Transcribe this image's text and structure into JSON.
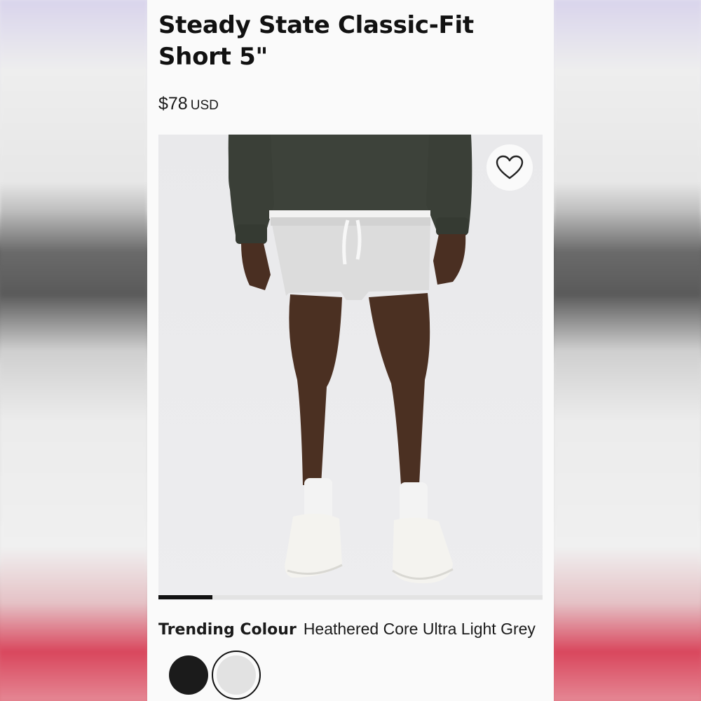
{
  "product": {
    "title": "Steady State Classic-Fit Short 5\"",
    "price": "$78",
    "currency": "USD"
  },
  "gallery": {
    "favorite_icon": "heart-outline-icon",
    "progress": 0.14
  },
  "colour": {
    "label": "Trending Colour",
    "selected_name": "Heathered Core Ultra Light Grey",
    "swatches": [
      {
        "name": "Black",
        "color": "#1b1b1b",
        "selected": false
      },
      {
        "name": "Heathered Core Ultra Light Grey",
        "color": "#e2e2e2",
        "selected": true
      }
    ]
  }
}
